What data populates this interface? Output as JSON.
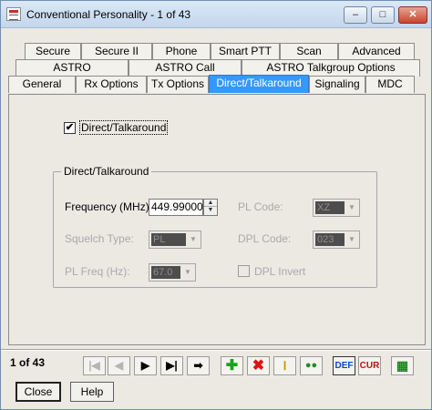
{
  "window": {
    "title": "Conventional Personality - 1 of 43",
    "min_label": "–",
    "max_label": "□",
    "close_label": "✕"
  },
  "tabs": {
    "row1": [
      "Secure",
      "Secure II",
      "Phone",
      "Smart PTT",
      "Scan",
      "Advanced"
    ],
    "row2": [
      "ASTRO",
      "ASTRO Call",
      "ASTRO Talkgroup Options"
    ],
    "row3": [
      "General",
      "Rx Options",
      "Tx Options",
      "Direct/Talkaround",
      "Signaling",
      "MDC"
    ],
    "active": "Direct/Talkaround"
  },
  "panel": {
    "direct_checkbox": {
      "label": "Direct/Talkaround",
      "checked": true,
      "mark": "✔"
    },
    "group_title": "Direct/Talkaround",
    "frequency": {
      "label": "Frequency (MHz):",
      "value": "449.99000"
    },
    "squelch_type": {
      "label": "Squelch Type:",
      "value": "PL"
    },
    "pl_freq": {
      "label": "PL Freq (Hz):",
      "value": "67.0"
    },
    "pl_code": {
      "label": "PL Code:",
      "value": "XZ"
    },
    "dpl_code": {
      "label": "DPL Code:",
      "value": "023"
    },
    "dpl_invert": {
      "label": "DPL Invert",
      "checked": false
    }
  },
  "toolbar": {
    "record_counter": "1 of 43",
    "buttons": {
      "first": "|◀",
      "prev": "◀",
      "next": "▶",
      "last": "▶|",
      "goto": "➡",
      "add": "✚",
      "delete": "✖",
      "insert": "Ⅰ",
      "duplicate": "●●",
      "def": "DEF",
      "cur": "CUR",
      "grid": "▦"
    }
  },
  "footer": {
    "close_label": "Close",
    "help_label": "Help"
  }
}
